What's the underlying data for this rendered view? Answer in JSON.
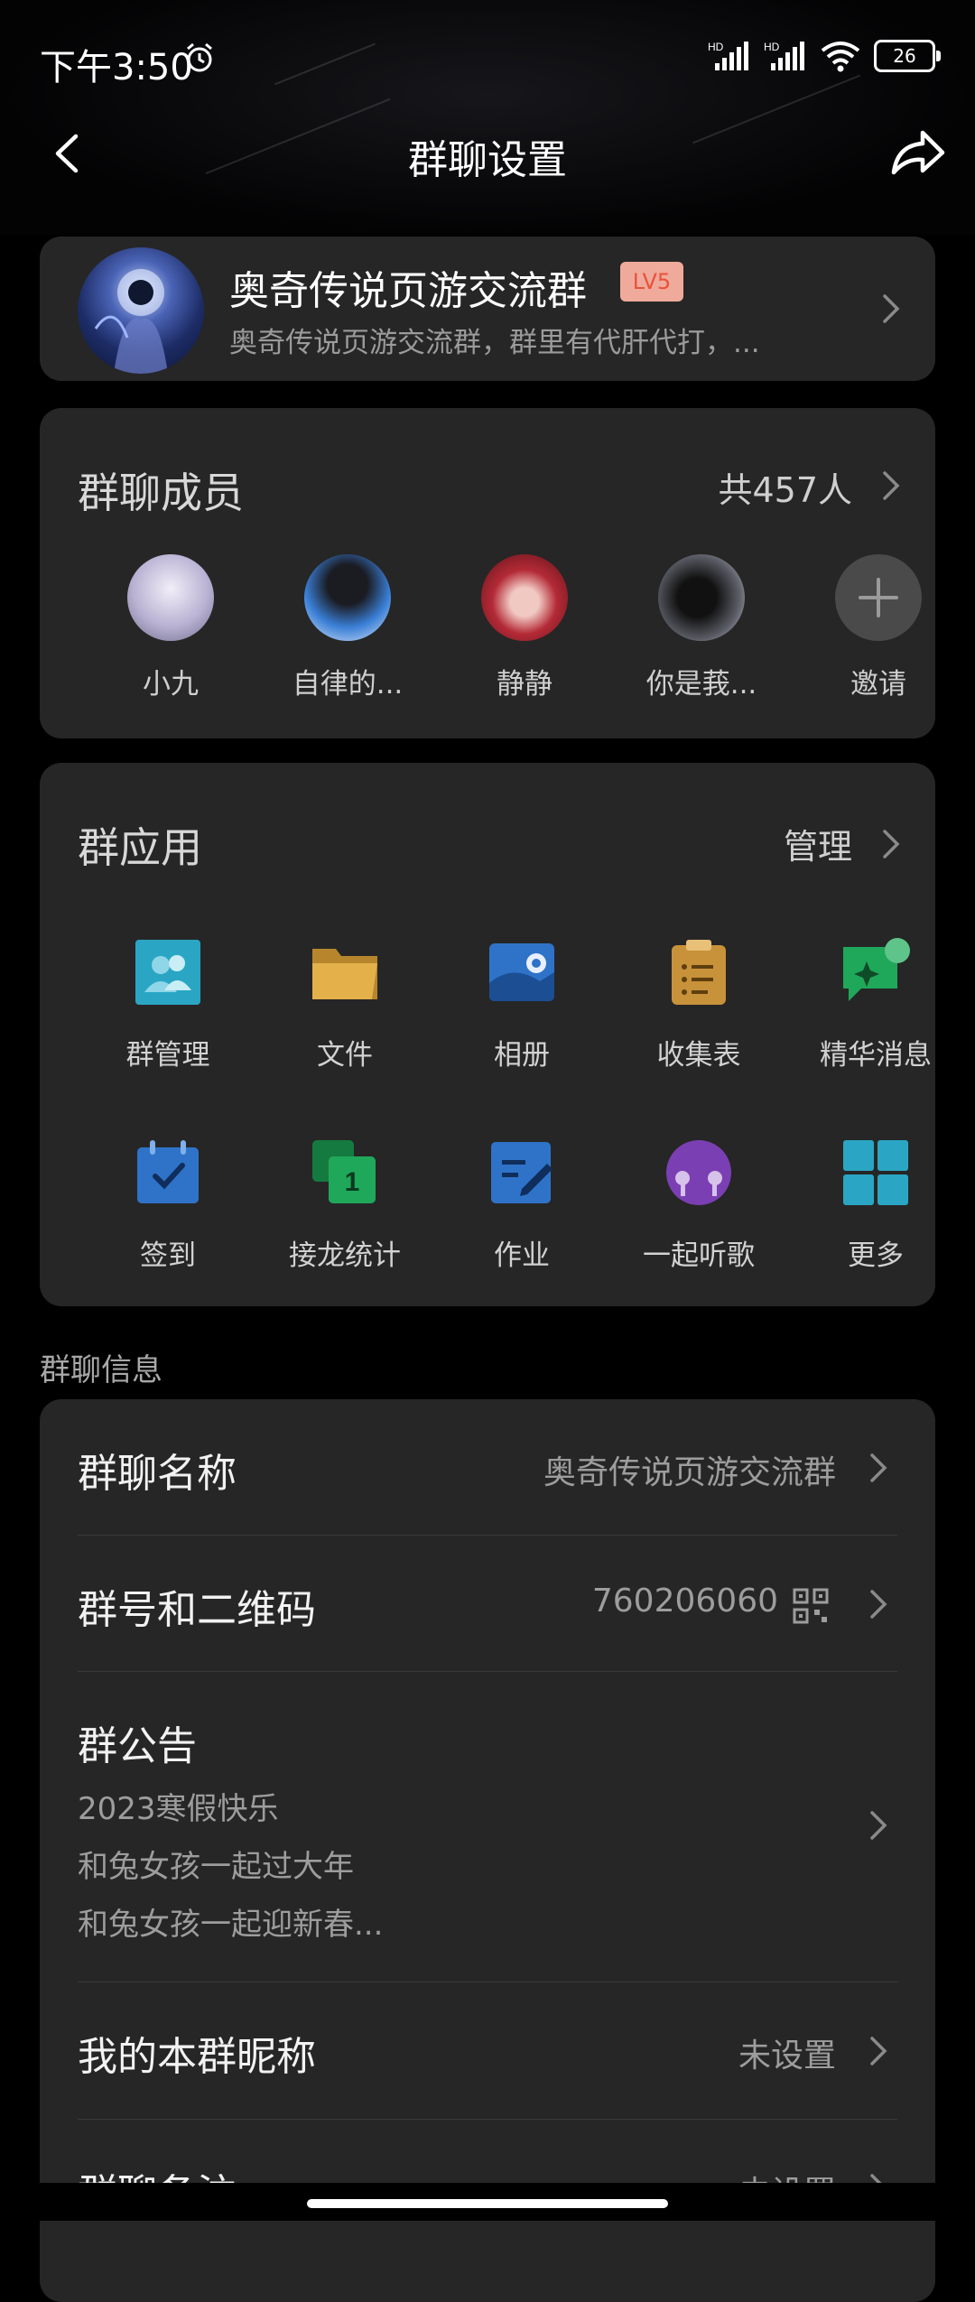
{
  "status_bar": {
    "time": "下午3:50",
    "battery": "26",
    "signal_labels": [
      "HD",
      "HD"
    ]
  },
  "nav": {
    "title": "群聊设置"
  },
  "group": {
    "name": "奥奇传说页游交流群",
    "level": "LV5",
    "description": "奥奇传说页游交流群，群里有代肝代打，..."
  },
  "members": {
    "title": "群聊成员",
    "count": "共457人",
    "list": [
      {
        "name": "小九"
      },
      {
        "name": "自律的..."
      },
      {
        "name": "静静"
      },
      {
        "name": "你是莪..."
      }
    ],
    "invite_label": "邀请"
  },
  "apps": {
    "title": "群应用",
    "manage_label": "管理",
    "items": [
      {
        "label": "群管理",
        "icon": "group-manage-icon",
        "color": "#2aa6c4"
      },
      {
        "label": "文件",
        "icon": "folder-icon",
        "color": "#d9a53d"
      },
      {
        "label": "相册",
        "icon": "photo-album-icon",
        "color": "#2f73c8"
      },
      {
        "label": "收集表",
        "icon": "clipboard-icon",
        "color": "#d9a53d"
      },
      {
        "label": "精华消息",
        "icon": "featured-message-icon",
        "color": "#1fa85a"
      },
      {
        "label": "签到",
        "icon": "checkin-calendar-icon",
        "color": "#2f73c8"
      },
      {
        "label": "接龙统计",
        "icon": "chain-stats-icon",
        "color": "#1fa85a"
      },
      {
        "label": "作业",
        "icon": "homework-icon",
        "color": "#2f73c8"
      },
      {
        "label": "一起听歌",
        "icon": "listen-together-icon",
        "color": "#7b3fb4"
      },
      {
        "label": "更多",
        "icon": "more-grid-icon",
        "color": "#2aa6c4"
      }
    ]
  },
  "info": {
    "section_label": "群聊信息",
    "name_row": {
      "label": "群聊名称",
      "value": "奥奇传说页游交流群"
    },
    "id_row": {
      "label": "群号和二维码",
      "value": "760206060"
    },
    "notice_row": {
      "label": "群公告",
      "lines": [
        "2023寒假快乐",
        "和兔女孩一起过大年",
        "和兔女孩一起迎新春..."
      ]
    },
    "nickname_row": {
      "label": "我的本群昵称",
      "value": "未设置"
    },
    "remark_row": {
      "label": "群聊备注",
      "value": "未设置"
    }
  }
}
